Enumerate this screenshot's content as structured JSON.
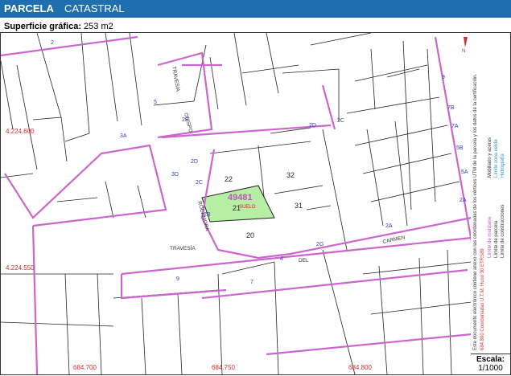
{
  "header": {
    "title": "PARCELA",
    "subtitle": "CATASTRAL"
  },
  "surface": {
    "label": "Superficie gráfica:",
    "value": "253 m2"
  },
  "map": {
    "y_coords": [
      "4.224.600",
      "4.224.550"
    ],
    "x_coords": [
      "684.700",
      "684.750",
      "684.800"
    ],
    "parcel_id": "49481",
    "parcel_number": "21",
    "parcel_label": "SUELO",
    "lot_numbers": [
      "22",
      "32",
      "31",
      "20"
    ],
    "streets": [
      "TRAVESÍA",
      "OBISPO",
      "ROCAMORA",
      "CARMEN",
      "DEL",
      "TRAVESÍA"
    ],
    "street_numbers": [
      "2",
      "5",
      "3A",
      "3D",
      "2E",
      "2D",
      "2C",
      "2B",
      "2A",
      "4",
      "2G",
      "9",
      "7",
      "2D",
      "2C",
      "9",
      "7B",
      "7A",
      "5B",
      "5A",
      "2A"
    ],
    "colors": {
      "subject_fill": "#b6eea4",
      "block_line": "#cc66cc",
      "line": "#222222",
      "coord": "#d03030",
      "number": "#2a3fbf"
    }
  },
  "legend": {
    "items": [
      "Límite de manzana",
      "Límite de parcela",
      "Límite de construcciones",
      "Mobiliario y aceras",
      "Límite zona verde",
      "Hidrografía"
    ],
    "note": "Este documento electrónico contiene anexo con las coordenadas de los vértices UTM de la parcela y los datos de la certificación.",
    "crs": "684.800 Coordenadas U.T.M. Huso 30 ETRS89"
  },
  "scale": {
    "label": "Escala:",
    "value": "1/1000"
  }
}
